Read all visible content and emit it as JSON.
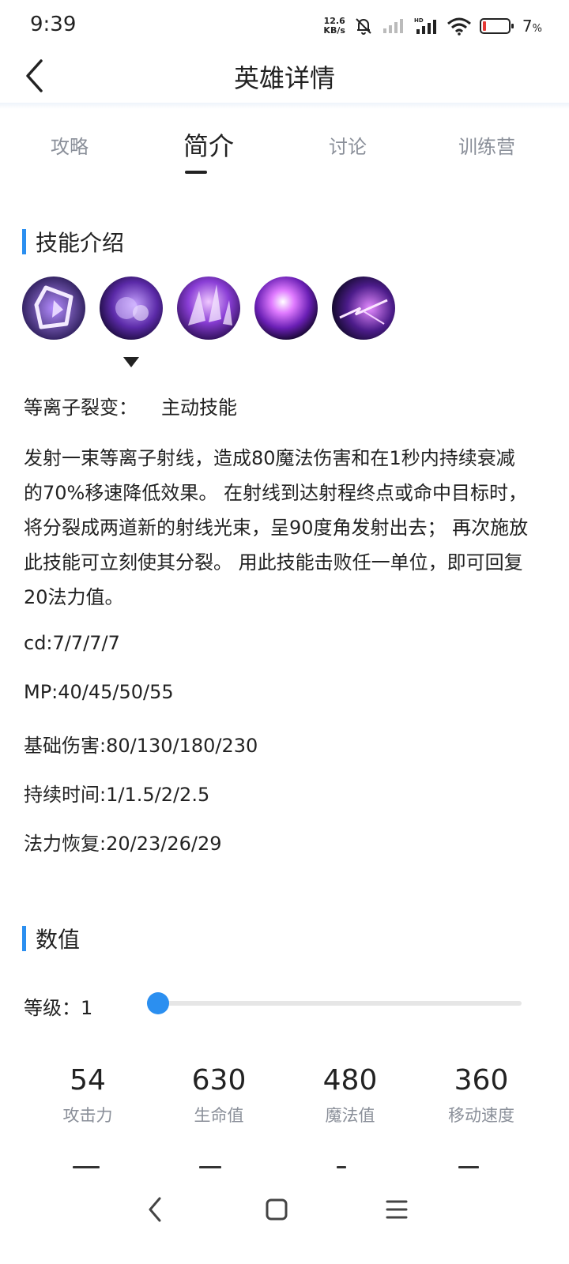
{
  "status_bar": {
    "time": "9:39",
    "net_speed_value": "12.6",
    "net_speed_unit": "KB/s",
    "battery_percent": "7",
    "battery_suffix": "%"
  },
  "header": {
    "title": "英雄详情"
  },
  "tabs": [
    {
      "label": "攻略",
      "active": false
    },
    {
      "label": "简介",
      "active": true
    },
    {
      "label": "讨论",
      "active": false
    },
    {
      "label": "训练营",
      "active": false
    }
  ],
  "skills_section": {
    "title": "技能介绍",
    "icons": [
      "plasma-rune-icon",
      "smoke-orb-icon",
      "crystal-burst-icon",
      "violet-explosion-icon",
      "lightning-split-icon"
    ],
    "selected_index": 1,
    "selected_skill": {
      "name": "等离子裂变：",
      "type": "主动技能",
      "description": "发射一束等离子射线，造成80魔法伤害和在1秒内持续衰减的70%移速降低效果。 在射线到达射程终点或命中目标时，将分裂成两道新的射线光束，呈90度角发射出去； 再次施放此技能可立刻使其分裂。 用此技能击败任一单位，即可回复20法力值。",
      "stats": [
        "cd:7/7/7/7",
        "MP:40/45/50/55",
        "基础伤害:80/130/180/230",
        "持续时间:1/1.5/2/2.5",
        "法力恢复:20/23/26/29"
      ]
    }
  },
  "values_section": {
    "title": "数值",
    "level_label": "等级：",
    "level_value": "1",
    "level_fraction": 0,
    "stats": [
      {
        "value": "54",
        "label": "攻击力"
      },
      {
        "value": "630",
        "label": "生命值"
      },
      {
        "value": "480",
        "label": "魔法值"
      },
      {
        "value": "360",
        "label": "移动速度"
      }
    ]
  },
  "colors": {
    "accent": "#2b8ff0",
    "text_primary": "#222222",
    "text_secondary": "#8a8f99",
    "skill_purple": "#7b2fd4"
  },
  "bottom_nav": {
    "icons": [
      "back-nav-icon",
      "home-nav-icon",
      "menu-nav-icon"
    ]
  }
}
